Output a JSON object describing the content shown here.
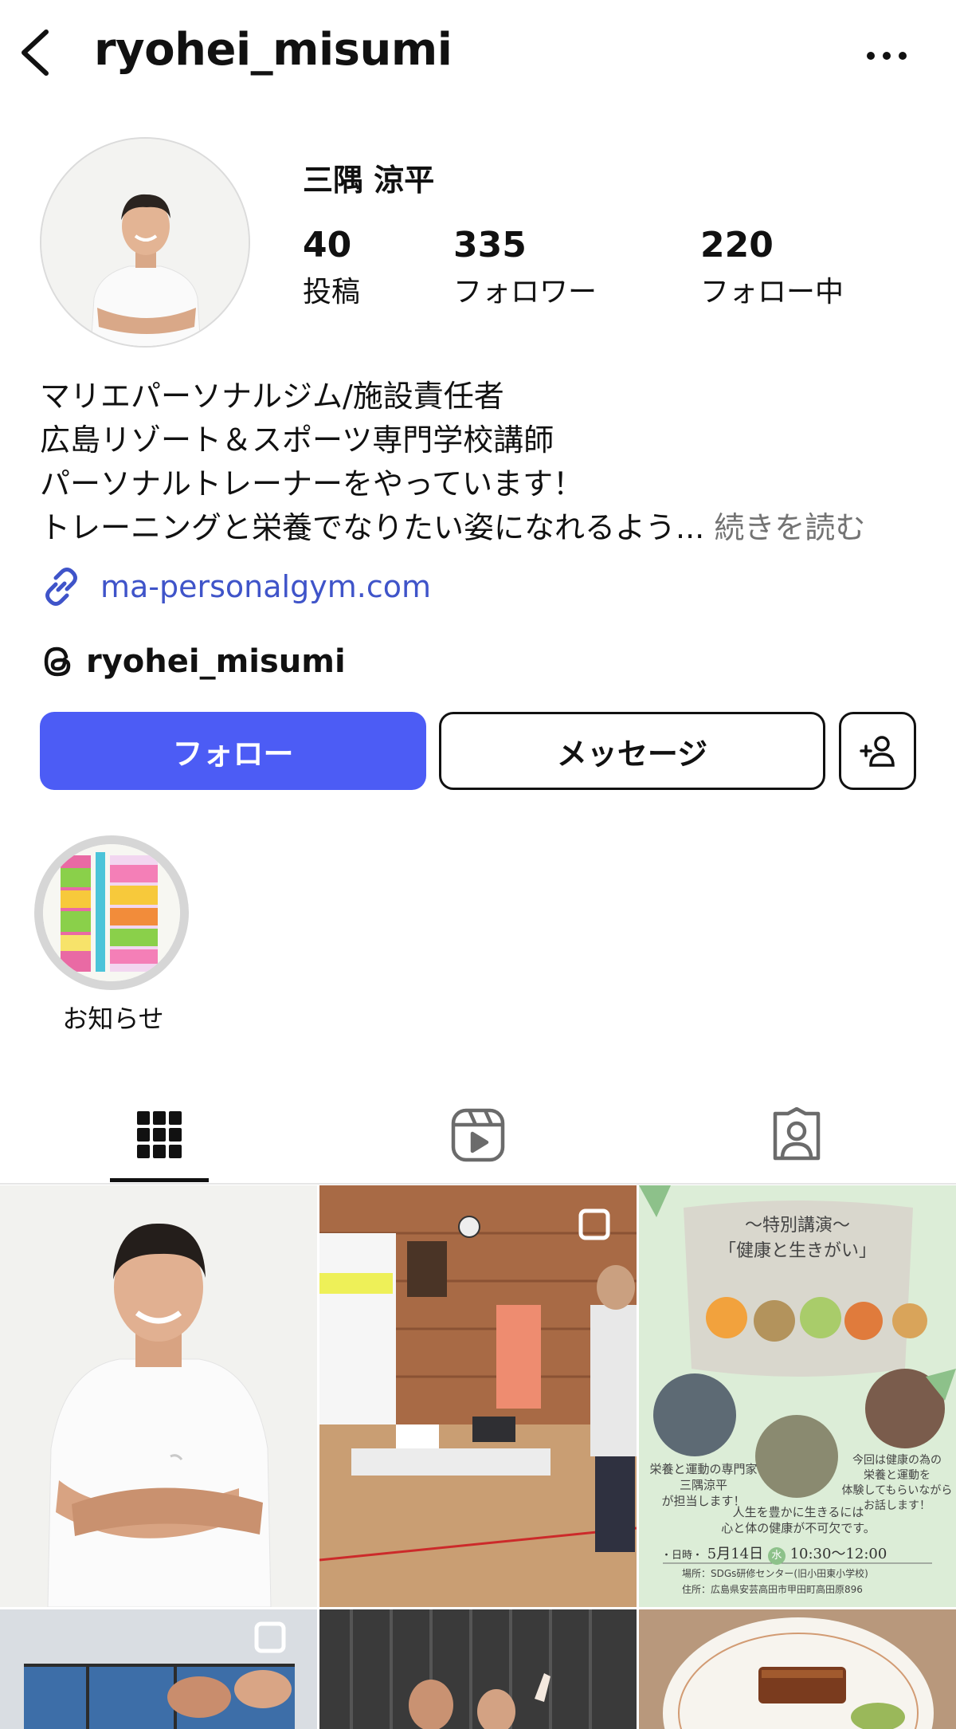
{
  "header": {
    "username": "ryohei_misumi"
  },
  "profile": {
    "display_name": "三隅 涼平",
    "stats": [
      {
        "count": "40",
        "label": "投稿"
      },
      {
        "count": "335",
        "label": "フォロワー"
      },
      {
        "count": "220",
        "label": "フォロー中"
      }
    ],
    "bio_lines": [
      "マリエパーソナルジム/施設責任者",
      "広島リゾート＆スポーツ専門学校講師",
      "パーソナルトレーナーをやっています！",
      "トレーニングと栄養でなりたい姿になれるよう..."
    ],
    "bio_more": "続きを読む",
    "link": "ma-personalgym.com",
    "threads_handle": "ryohei_misumi"
  },
  "actions": {
    "follow": "フォロー",
    "message": "メッセージ"
  },
  "highlights": [
    {
      "label": "お知らせ"
    }
  ],
  "posts": {
    "post3": {
      "title_line1": "〜特別講演〜",
      "title_line2": "「健康と生きがい」",
      "text_left_1": "栄養と運動の専門家",
      "text_left_2": "三隅涼平",
      "text_left_3": "が担当します！",
      "text_right_1": "今回は健康の為の",
      "text_right_2": "栄養と運動を",
      "text_right_3": "体験してもらいながら",
      "text_right_4": "お話します！",
      "text_center_1": "人生を豊かに生きるには",
      "text_center_2": "心と体の健康が不可欠です。",
      "date_label": "・日時・",
      "date": "5月14日",
      "weekday": "水",
      "time": "10:30〜12:00",
      "venue": "場所：SDGs研修センター(旧小田東小学校)",
      "address": "住所：広島県安芸高田市甲田町高田原896"
    }
  },
  "colors": {
    "accent": "#4c5cf5",
    "link": "#3f54c9",
    "muted": "#737373"
  }
}
